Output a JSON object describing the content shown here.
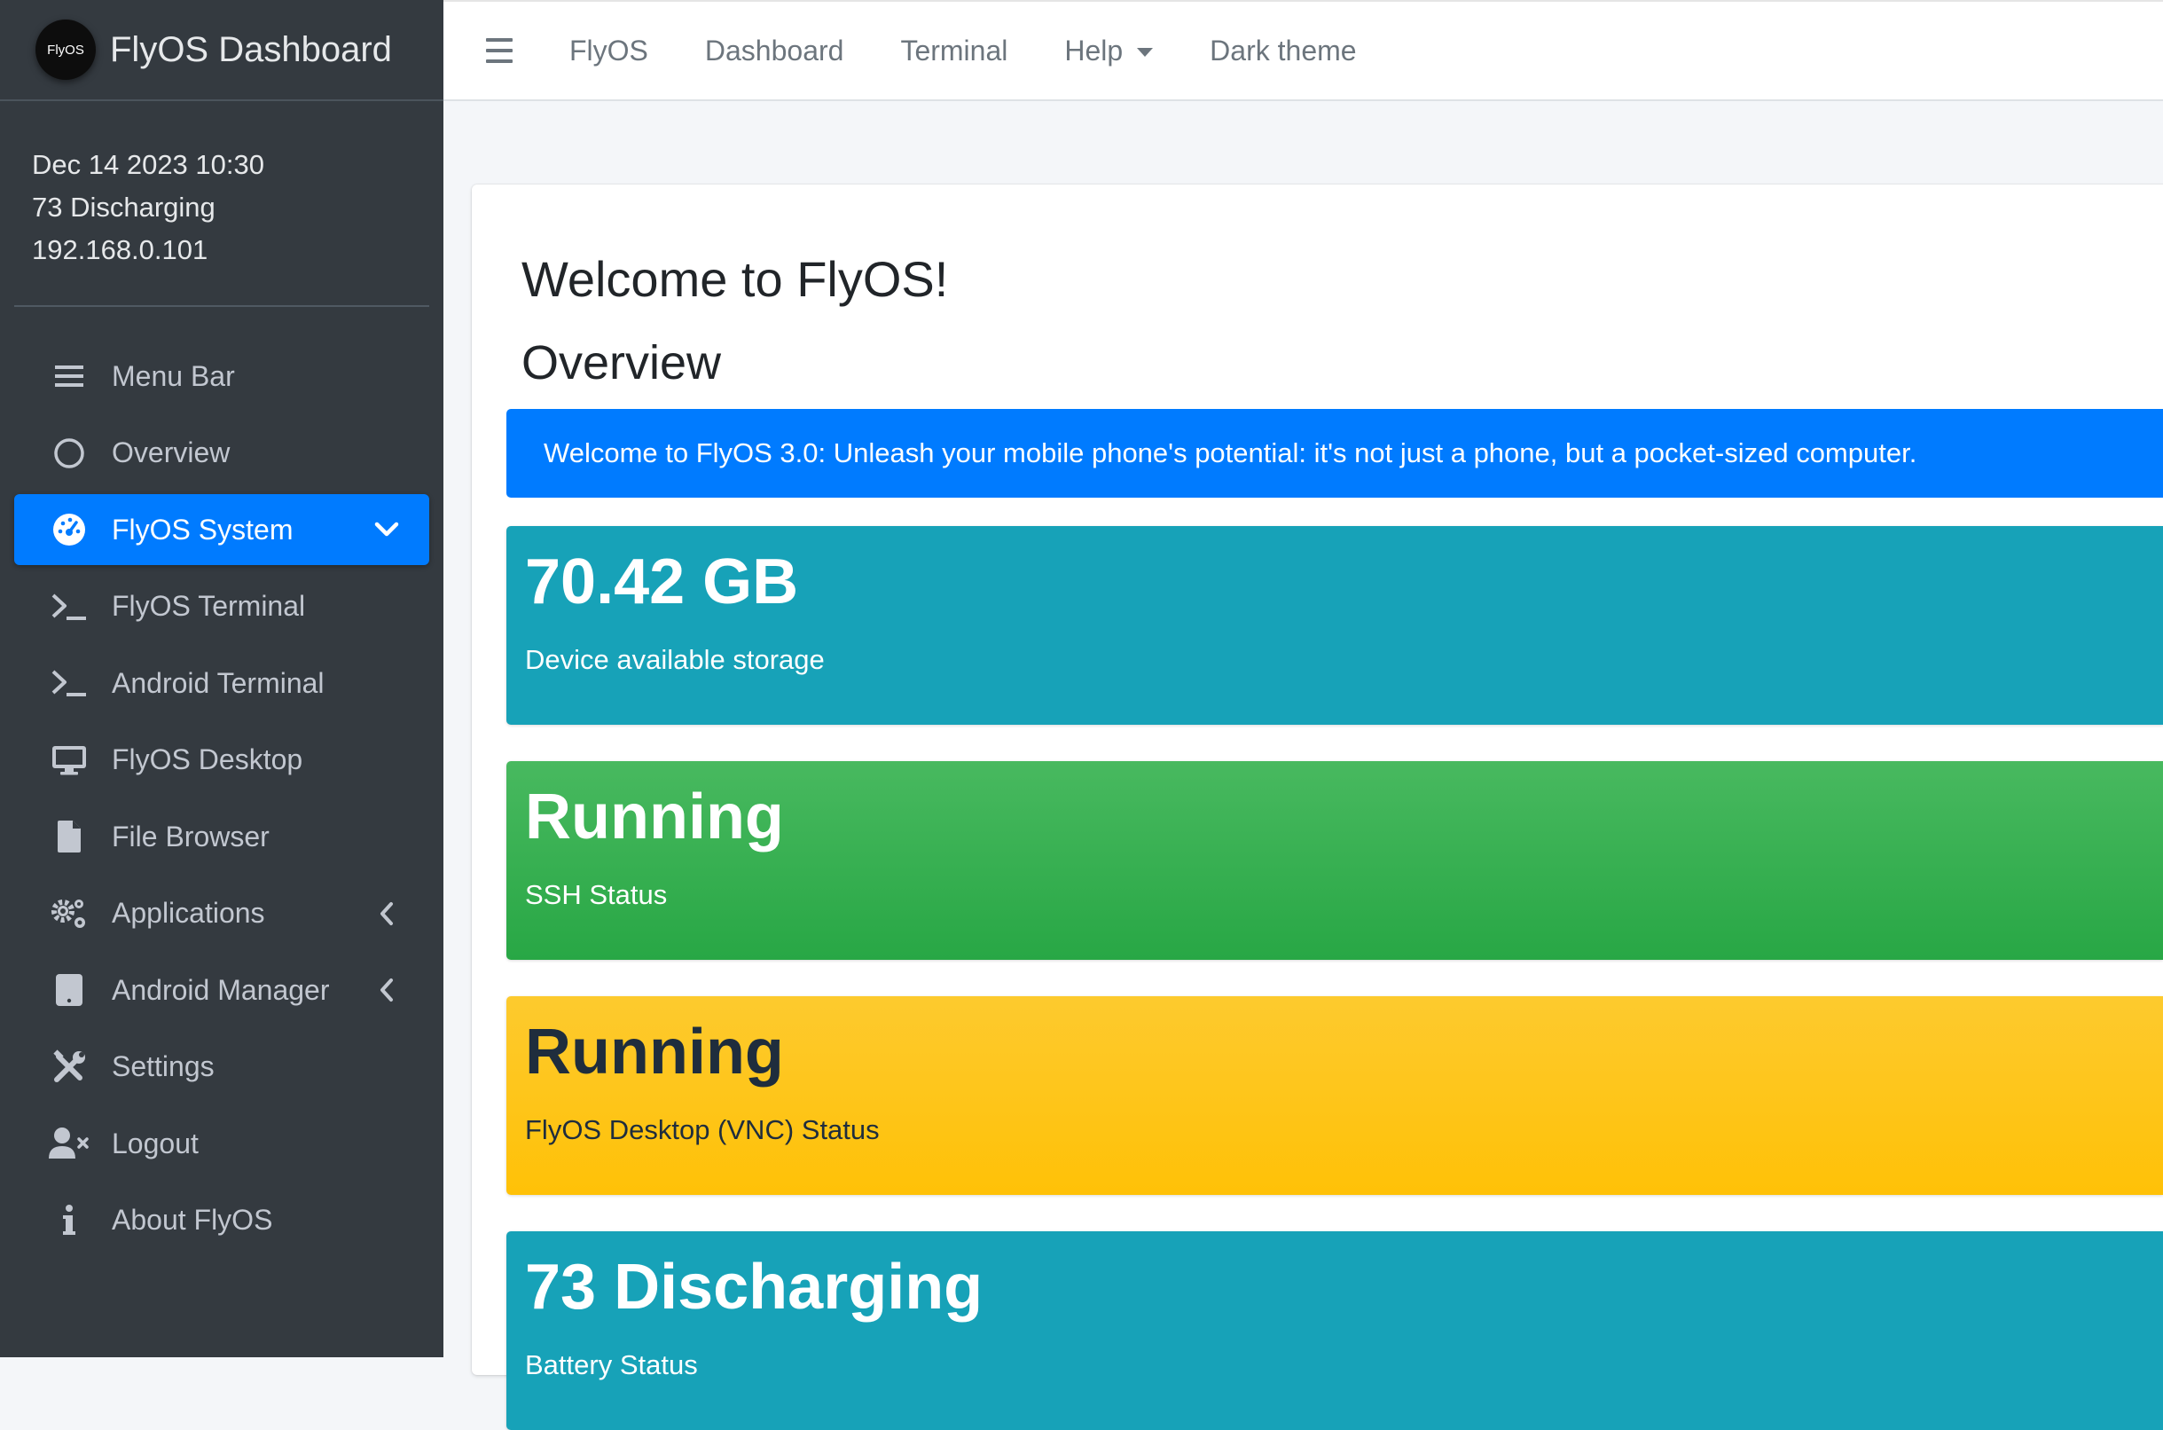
{
  "brand": {
    "logo_text": "FlyOS",
    "title": "FlyOS Dashboard"
  },
  "system_info": {
    "datetime": "Dec 14 2023 10:30",
    "battery": "73 Discharging",
    "ip": "192.168.0.101"
  },
  "sidebar": {
    "items": [
      {
        "label": "Menu Bar",
        "icon": "bars-icon"
      },
      {
        "label": "Overview",
        "icon": "circle-icon"
      },
      {
        "label": "FlyOS System",
        "icon": "dashboard-icon",
        "active": true
      },
      {
        "label": "FlyOS Terminal",
        "icon": "terminal-icon"
      },
      {
        "label": "Android Terminal",
        "icon": "terminal-icon"
      },
      {
        "label": "FlyOS Desktop",
        "icon": "desktop-icon"
      },
      {
        "label": "File Browser",
        "icon": "file-icon"
      },
      {
        "label": "Applications",
        "icon": "cogs-icon"
      },
      {
        "label": "Android Manager",
        "icon": "tablet-icon"
      },
      {
        "label": "Settings",
        "icon": "tools-icon"
      },
      {
        "label": "Logout",
        "icon": "user-times-icon"
      },
      {
        "label": "About FlyOS",
        "icon": "info-icon"
      }
    ]
  },
  "topbar": {
    "links": [
      "FlyOS",
      "Dashboard",
      "Terminal",
      "Help",
      "Dark theme"
    ]
  },
  "main": {
    "welcome": "Welcome to FlyOS!",
    "overview": "Overview",
    "alert": "Welcome to FlyOS 3.0: Unleash your mobile phone's potential: it's not just a phone, but a pocket-sized computer.",
    "boxes": [
      {
        "value": "70.42 GB",
        "label": "Device available storage"
      },
      {
        "value": "Running",
        "label": "SSH Status"
      },
      {
        "value": "Running",
        "label": "FlyOS Desktop (VNC) Status"
      },
      {
        "value": "73 Discharging",
        "label": "Battery Status"
      }
    ]
  },
  "colors": {
    "sidebar_bg": "#343a40",
    "primary": "#007bff",
    "info": "#17a2b8",
    "success": "#28a745",
    "warning": "#ffc107"
  }
}
